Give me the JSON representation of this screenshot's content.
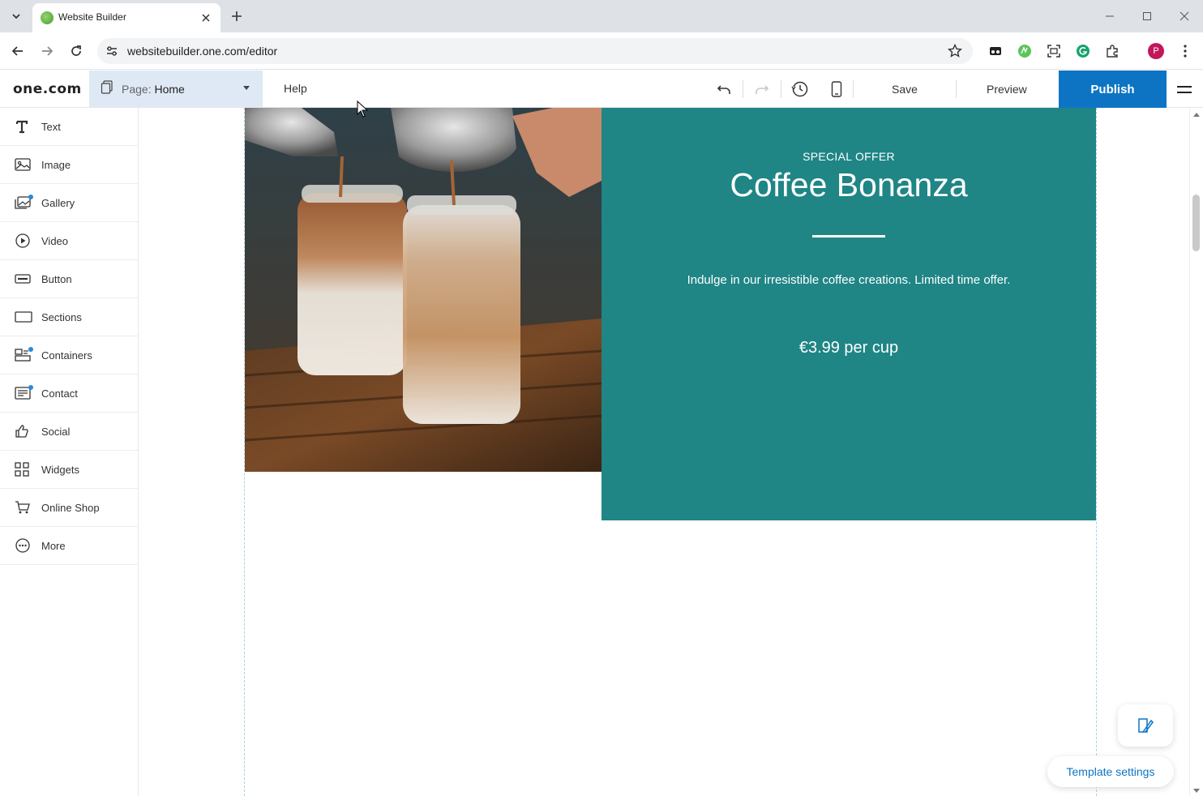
{
  "browser": {
    "tab_title": "Website Builder",
    "url": "websitebuilder.one.com/editor",
    "profile_initial": "P"
  },
  "editor": {
    "logo": "one.com",
    "page_prefix": "Page:",
    "page_name": "Home",
    "help_label": "Help",
    "save_label": "Save",
    "preview_label": "Preview",
    "publish_label": "Publish"
  },
  "sidebar": {
    "items": [
      {
        "label": "Text",
        "icon": "text-icon",
        "dot": false
      },
      {
        "label": "Image",
        "icon": "image-icon",
        "dot": false
      },
      {
        "label": "Gallery",
        "icon": "gallery-icon",
        "dot": true
      },
      {
        "label": "Video",
        "icon": "video-icon",
        "dot": false
      },
      {
        "label": "Button",
        "icon": "button-icon",
        "dot": false
      },
      {
        "label": "Sections",
        "icon": "sections-icon",
        "dot": false
      },
      {
        "label": "Containers",
        "icon": "containers-icon",
        "dot": true
      },
      {
        "label": "Contact",
        "icon": "contact-icon",
        "dot": true
      },
      {
        "label": "Social",
        "icon": "social-icon",
        "dot": false
      },
      {
        "label": "Widgets",
        "icon": "widgets-icon",
        "dot": false
      },
      {
        "label": "Online Shop",
        "icon": "cart-icon",
        "dot": false
      },
      {
        "label": "More",
        "icon": "more-icon",
        "dot": false
      }
    ]
  },
  "offer": {
    "kicker": "SPECIAL OFFER",
    "title": "Coffee Bonanza",
    "description": "Indulge in our irresistible coffee creations. Limited time offer.",
    "price": "€3.99 per cup"
  },
  "floating": {
    "template_settings_label": "Template settings"
  },
  "colors": {
    "offer_bg": "#1f8585",
    "publish_bg": "#0d74c4",
    "page_select_bg": "#dfe9f5",
    "guide": "#a7d3e3"
  }
}
